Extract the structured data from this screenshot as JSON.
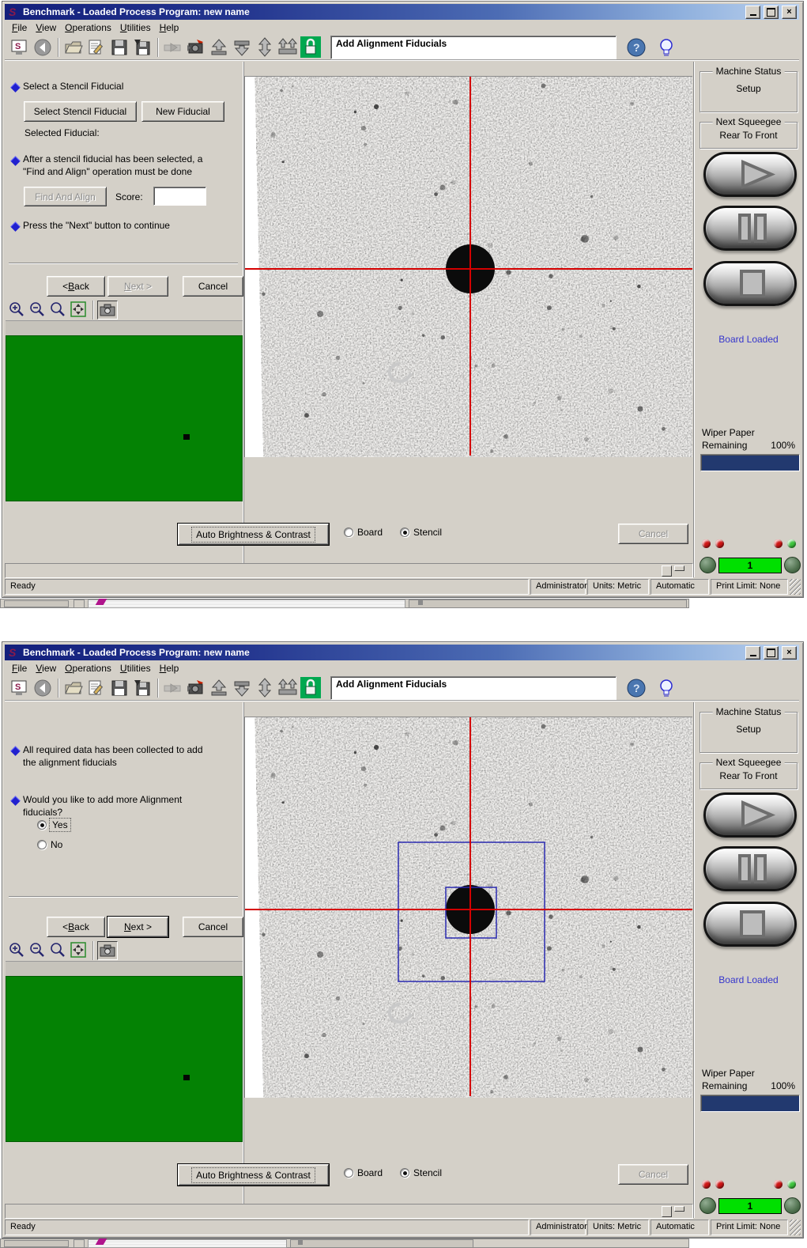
{
  "window": {
    "title": "Benchmark - Loaded Process Program:  new name"
  },
  "menu": {
    "items": [
      {
        "u": "F",
        "rest": "ile"
      },
      {
        "u": "V",
        "rest": "iew"
      },
      {
        "u": "O",
        "rest": "perations"
      },
      {
        "u": "U",
        "rest": "tilities"
      },
      {
        "u": "H",
        "rest": "elp"
      }
    ]
  },
  "toolbar": {
    "task_label": "Add Alignment Fiducials"
  },
  "icons": {
    "logo": "benchmark-logo",
    "back": "back-arrow",
    "open": "open-folder",
    "edit": "edit-document",
    "save": "save-floppy",
    "save_as": "save-as-floppy",
    "load_board": "load-board",
    "vision": "vision-camera",
    "raise": "raise-stencil",
    "lower": "lower-board",
    "updown": "up-down-move",
    "squeegees": "squeegee-arrows",
    "lock": "safety-lock",
    "help": "help-question",
    "hint": "hint-lightbulb",
    "zoom_in": "zoom-in",
    "zoom_out": "zoom-out",
    "zoom": "zoom",
    "pan": "pan-fit",
    "snapshot": "camera-snapshot",
    "play": "run-play",
    "pause": "pause",
    "stop": "stop"
  },
  "wizard1": {
    "step1_text": "Select a Stencil Fiducial",
    "select_btn": "Select Stencil Fiducial",
    "new_btn": "New Fiducial",
    "selected_label": "Selected Fiducial:",
    "step2_lines": [
      "After a stencil fiducial has been selected, a",
      "\"Find and Align\" operation must be done"
    ],
    "find_btn": "Find And Align",
    "score_label": "Score:",
    "step3_text": "Press the \"Next\" button to continue"
  },
  "wizard2": {
    "step1_lines": [
      "All required data has been collected to add",
      "the alignment fiducials"
    ],
    "step2_lines": [
      "Would you like to add more Alignment",
      "fiducials?"
    ],
    "yes_label": "Yes",
    "no_label": "No"
  },
  "nav": {
    "back_prefix": "< ",
    "back_u": "B",
    "back_rest": "ack",
    "next_u": "N",
    "next_rest": "ext >",
    "cancel": "Cancel"
  },
  "camera": {
    "auto_btn": "Auto Brightness & Contrast",
    "board_label": "Board",
    "stencil_label": "Stencil",
    "cancel_btn": "Cancel"
  },
  "machine": {
    "status_group": "Machine Status",
    "status_value": "Setup",
    "squeegee_group": "Next Squeegee",
    "squeegee_value": "Rear To Front",
    "board_loaded": "Board Loaded",
    "wiper_line1": "Wiper Paper",
    "wiper_line2": "Remaining",
    "wiper_pct": "100%",
    "counter": "1"
  },
  "statusbar": {
    "ready": "Ready",
    "user": "Administrator",
    "units": "Units: Metric",
    "mode": "Automatic",
    "print_limit": "Print Limit: None"
  },
  "colors": {
    "crosshair_red": "#d40000",
    "viewport_green": "#048204",
    "counter_green": "#00e000",
    "wiper_bar_navy": "#22396f",
    "board_loaded_blue": "#3535cc",
    "lock_green": "#00a850",
    "titlebar_navy": "#131f7c",
    "window_gray": "#d4d0c8",
    "search_box_blue": "#2a2ab0"
  }
}
